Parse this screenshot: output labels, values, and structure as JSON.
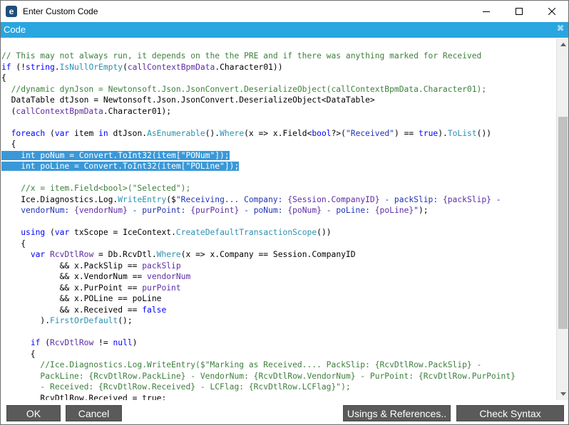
{
  "window": {
    "title": "Enter Custom Code",
    "app_icon_glyph": "e"
  },
  "panel": {
    "title": "Code",
    "pin_glyph": "⌘"
  },
  "editor": {
    "lines": [
      [
        [
          "c",
          "// This may not always run, it depends on the the PRE and if there was anything marked for Received"
        ]
      ],
      [
        [
          "k",
          "if"
        ],
        [
          "p",
          " (!"
        ],
        [
          "k",
          "string"
        ],
        [
          "p",
          "."
        ],
        [
          "m",
          "IsNullOrEmpty"
        ],
        [
          "p",
          "("
        ],
        [
          "i",
          "callContextBpmData"
        ],
        [
          "p",
          ".Character01))"
        ]
      ],
      [
        [
          "p",
          "{"
        ]
      ],
      [
        [
          "c",
          "  //dynamic dynJson = Newtonsoft.Json.JsonConvert.DeserializeObject(callContextBpmData.Character01);"
        ]
      ],
      [
        [
          "p",
          "  DataTable dtJson = Newtonsoft.Json.JsonConvert.DeserializeObject<DataTable>"
        ]
      ],
      [
        [
          "p",
          "  ("
        ],
        [
          "i",
          "callContextBpmData"
        ],
        [
          "p",
          ".Character01);"
        ]
      ],
      [
        [
          "p",
          ""
        ]
      ],
      [
        [
          "p",
          "  "
        ],
        [
          "k",
          "foreach"
        ],
        [
          "p",
          " ("
        ],
        [
          "k",
          "var"
        ],
        [
          "p",
          " item "
        ],
        [
          "k",
          "in"
        ],
        [
          "p",
          " dtJson."
        ],
        [
          "m",
          "AsEnumerable"
        ],
        [
          "p",
          "()."
        ],
        [
          "m",
          "Where"
        ],
        [
          "p",
          "(x => x.Field<"
        ],
        [
          "k",
          "bool"
        ],
        [
          "p",
          "?>("
        ],
        [
          "s",
          "\"Received\""
        ],
        [
          "p",
          ") == "
        ],
        [
          "k",
          "true"
        ],
        [
          "p",
          ")."
        ],
        [
          "m",
          "ToList"
        ],
        [
          "p",
          "())"
        ]
      ],
      [
        [
          "p",
          "  {"
        ]
      ],
      [
        [
          "h",
          "    int poNum = Convert.ToInt32(item[\"PONum\"]);"
        ]
      ],
      [
        [
          "h",
          "    int poLine = Convert.ToInt32(item[\"POLine\"]);"
        ]
      ],
      [
        [
          "p",
          ""
        ]
      ],
      [
        [
          "c",
          "    //x = item.Field<bool>(\"Selected\");"
        ]
      ],
      [
        [
          "p",
          "    Ice.Diagnostics.Log."
        ],
        [
          "m",
          "WriteEntry"
        ],
        [
          "p",
          "($"
        ],
        [
          "s",
          "\"Receiving... Company: "
        ],
        [
          "i",
          "{Session.CompanyID}"
        ],
        [
          "s",
          " - packSlip: "
        ],
        [
          "i",
          "{packSlip}"
        ],
        [
          "s",
          " -"
        ]
      ],
      [
        [
          "s",
          "    vendorNum: "
        ],
        [
          "i",
          "{vendorNum}"
        ],
        [
          "s",
          " - purPoint: "
        ],
        [
          "i",
          "{purPoint}"
        ],
        [
          "s",
          " - poNum: "
        ],
        [
          "i",
          "{poNum}"
        ],
        [
          "s",
          " - poLine: "
        ],
        [
          "i",
          "{poLine}"
        ],
        [
          "s",
          "\""
        ],
        [
          "p",
          ");"
        ]
      ],
      [
        [
          "p",
          ""
        ]
      ],
      [
        [
          "p",
          "    "
        ],
        [
          "k",
          "using"
        ],
        [
          "p",
          " ("
        ],
        [
          "k",
          "var"
        ],
        [
          "p",
          " txScope = IceContext."
        ],
        [
          "m",
          "CreateDefaultTransactionScope"
        ],
        [
          "p",
          "())"
        ]
      ],
      [
        [
          "p",
          "    {"
        ]
      ],
      [
        [
          "p",
          "      "
        ],
        [
          "k",
          "var"
        ],
        [
          "p",
          " "
        ],
        [
          "i",
          "RcvDtlRow"
        ],
        [
          "p",
          " = Db.RcvDtl."
        ],
        [
          "m",
          "Where"
        ],
        [
          "p",
          "(x => x.Company == Session.CompanyID"
        ]
      ],
      [
        [
          "p",
          "            && x.PackSlip == "
        ],
        [
          "i",
          "packSlip"
        ]
      ],
      [
        [
          "p",
          "            && x.VendorNum == "
        ],
        [
          "i",
          "vendorNum"
        ]
      ],
      [
        [
          "p",
          "            && x.PurPoint == "
        ],
        [
          "i",
          "purPoint"
        ]
      ],
      [
        [
          "p",
          "            && x.POLine == poLine"
        ]
      ],
      [
        [
          "p",
          "            && x.Received == "
        ],
        [
          "k",
          "false"
        ]
      ],
      [
        [
          "p",
          "        )."
        ],
        [
          "m",
          "FirstOrDefault"
        ],
        [
          "p",
          "();"
        ]
      ],
      [
        [
          "p",
          ""
        ]
      ],
      [
        [
          "p",
          "      "
        ],
        [
          "k",
          "if"
        ],
        [
          "p",
          " ("
        ],
        [
          "i",
          "RcvDtlRow"
        ],
        [
          "p",
          " != "
        ],
        [
          "k",
          "null"
        ],
        [
          "p",
          ")"
        ]
      ],
      [
        [
          "p",
          "      {"
        ]
      ],
      [
        [
          "c",
          "        //Ice.Diagnostics.Log.WriteEntry($\"Marking as Received.... PackSlip: {RcvDtlRow.PackSlip} -"
        ]
      ],
      [
        [
          "c",
          "        PackLine: {RcvDtlRow.PackLine} - VendorNum: {RcvDtlRow.VendorNum} - PurPoint: {RcvDtlRow.PurPoint}"
        ]
      ],
      [
        [
          "c",
          "        - Received: {RcvDtlRow.Received} - LCFlag: {RcvDtlRow.LCFlag}\");"
        ]
      ],
      [
        [
          "p",
          "        RcvDtlRow.Received = true;"
        ]
      ]
    ]
  },
  "footer": {
    "ok_label": "OK",
    "cancel_label": "Cancel",
    "usings_label": "Usings & References..",
    "check_syntax_label": "Check Syntax"
  },
  "colors": {
    "panel_header": "#29a6e0",
    "button_bg": "#5a5a5a",
    "selection": "#3a98d8",
    "comment": "#3d7f3d",
    "keyword": "#0000ff",
    "method": "#2b91af"
  }
}
